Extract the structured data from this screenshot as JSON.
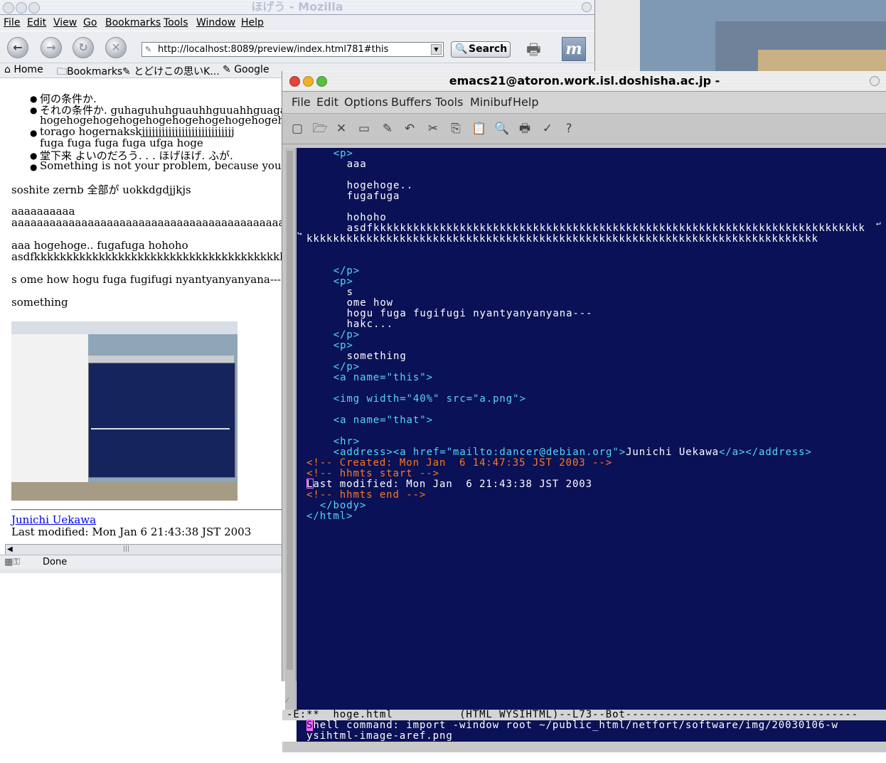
{
  "mozilla": {
    "title": "ほげう - Mozilla",
    "menu": [
      "File",
      "Edit",
      "View",
      "Go",
      "Bookmarks",
      "Tools",
      "Window",
      "Help"
    ],
    "url": "http://localhost:8089/preview/index.html781#this",
    "search_label": "Search",
    "personal_bar": {
      "home": "Home",
      "bookmarks": "Bookmarks",
      "link1": "とどけこの思いK...",
      "link2": "Google"
    },
    "content": {
      "list": [
        "何の条件か.",
        "それの条件か.  guhaguhuhguauhhguuahhguagahg",
        "torago hogernakskjjjjjjjjjjjjjjjjjjjjjjjjjjjj",
        "堂下来 よいのだろう. . .  ほげほげ. ふが.",
        "Something is not your problem, because you"
      ],
      "list_cont": [
        "hogehogehogehogehogehogehogehogehogehogehogehog",
        "fuga fuga fuga fuga ufga hoge"
      ],
      "p1": "soshite zernb 全部が uokkdgdjjkjs",
      "p2a": "aaaaaaaaaa",
      "p2b": "aaaaaaaaaaaaaaaaaaaaaaaaaaaaaaaaaaaaaaaaaaaaaaaaaaa",
      "p3a": "aaa hogehoge.. fugafuga hohoho",
      "p3b": "asdfkkkkkkkkkkkkkkkkkkkkkkkkkkkkkkkkkkkkkkkkkkkkk",
      "p4": "s ome how hogu fuga fugifugi nyantyanyanyana---",
      "p5": "something",
      "address": "Junichi Uekawa",
      "modified": "Last modified: Mon Jan 6 21:43:38 JST 2003"
    },
    "status": "Done"
  },
  "emacs": {
    "title": "emacs21@atoron.work.isl.doshisha.ac.jp -",
    "menu": [
      "File",
      "Edit",
      "Options",
      "Buffers",
      "Tools",
      "Minibuf",
      "Help"
    ],
    "buffer": [
      {
        "ind": 4,
        "parts": [
          {
            "t": "<p>",
            "c": "c-tag"
          }
        ]
      },
      {
        "ind": 6,
        "parts": [
          {
            "t": "aaa",
            "c": "c-txt"
          }
        ]
      },
      {
        "ind": 0,
        "parts": []
      },
      {
        "ind": 6,
        "parts": [
          {
            "t": "hogehoge..",
            "c": "c-txt"
          }
        ]
      },
      {
        "ind": 6,
        "parts": [
          {
            "t": "fugafuga",
            "c": "c-txt"
          }
        ]
      },
      {
        "ind": 0,
        "parts": []
      },
      {
        "ind": 6,
        "parts": [
          {
            "t": "hohoho",
            "c": "c-txt"
          }
        ]
      },
      {
        "ind": 6,
        "parts": [
          {
            "t": "asdfkkkkkkkkkkkkkkkkkkkkkkkkkkkkkkkkkkkkkkkkkkkkkkkkkkkkkkkkkkkkkkkkkkkkkkkkkk",
            "c": "c-txt"
          }
        ]
      },
      {
        "ind": 0,
        "parts": [
          {
            "t": "kkkkkkkkkkkkkkkkkkkkkkkkkkkkkkkkkkkkkkkkkkkkkkkkkkkkkkkkkkkkkkkkkkkkkkkkkkkkk",
            "c": "c-txt"
          }
        ]
      },
      {
        "ind": 0,
        "parts": []
      },
      {
        "ind": 0,
        "parts": []
      },
      {
        "ind": 4,
        "parts": [
          {
            "t": "</p>",
            "c": "c-tag"
          }
        ]
      },
      {
        "ind": 4,
        "parts": [
          {
            "t": "<p>",
            "c": "c-tag"
          }
        ]
      },
      {
        "ind": 6,
        "parts": [
          {
            "t": "s",
            "c": "c-txt"
          }
        ]
      },
      {
        "ind": 6,
        "parts": [
          {
            "t": "ome how",
            "c": "c-txt"
          }
        ]
      },
      {
        "ind": 6,
        "parts": [
          {
            "t": "hogu fuga fugifugi nyantyanyanyana---",
            "c": "c-txt"
          }
        ]
      },
      {
        "ind": 6,
        "parts": [
          {
            "t": "hakc...",
            "c": "c-txt"
          }
        ]
      },
      {
        "ind": 4,
        "parts": [
          {
            "t": "</p>",
            "c": "c-tag"
          }
        ]
      },
      {
        "ind": 4,
        "parts": [
          {
            "t": "<p>",
            "c": "c-tag"
          }
        ]
      },
      {
        "ind": 6,
        "parts": [
          {
            "t": "something",
            "c": "c-txt"
          }
        ]
      },
      {
        "ind": 4,
        "parts": [
          {
            "t": "</p>",
            "c": "c-tag"
          }
        ]
      },
      {
        "ind": 4,
        "parts": [
          {
            "t": "<a name=\"this\">",
            "c": "c-tag"
          }
        ]
      },
      {
        "ind": 0,
        "parts": []
      },
      {
        "ind": 4,
        "parts": [
          {
            "t": "<img width=\"40%\" src=\"a.png\">",
            "c": "c-tag"
          }
        ]
      },
      {
        "ind": 0,
        "parts": []
      },
      {
        "ind": 4,
        "parts": [
          {
            "t": "<a name=\"that\">",
            "c": "c-tag"
          }
        ]
      },
      {
        "ind": 0,
        "parts": []
      },
      {
        "ind": 4,
        "parts": [
          {
            "t": "<hr>",
            "c": "c-tag"
          }
        ]
      },
      {
        "ind": 4,
        "parts": [
          {
            "t": "<address><a href=\"mailto:dancer@debian.org\">",
            "c": "c-tag"
          },
          {
            "t": "Junichi Uekawa",
            "c": "c-txt"
          },
          {
            "t": "</a></address>",
            "c": "c-tag"
          }
        ]
      },
      {
        "ind": 0,
        "parts": [
          {
            "t": "<!-- Created: Mon Jan  6 14:47:35 JST 2003 -->",
            "c": "c-com"
          }
        ]
      },
      {
        "ind": 0,
        "parts": [
          {
            "t": "<!-- hhmts start -->",
            "c": "c-com"
          }
        ]
      },
      {
        "ind": 0,
        "parts": [
          {
            "t": "Last modified: Mon Jan  6 21:43:38 JST 2003",
            "c": "c-txt"
          }
        ]
      },
      {
        "ind": 0,
        "parts": [
          {
            "t": "<!-- hhmts end -->",
            "c": "c-com"
          }
        ]
      },
      {
        "ind": 2,
        "parts": [
          {
            "t": "</body>",
            "c": "c-tag"
          }
        ]
      },
      {
        "ind": 0,
        "parts": [
          {
            "t": "</html>",
            "c": "c-tag"
          }
        ]
      }
    ],
    "modeline": "-E:**  hoge.html          (HTML WYSIHTML)--L73--Bot-----------------------------------",
    "minibuffer": {
      "cursor_char": "S",
      "line1_rest": "hell command: import -window root ~/public_html/netfort/software/img/20030106-w",
      "line2": "ysihtml-image-aref.png"
    }
  }
}
